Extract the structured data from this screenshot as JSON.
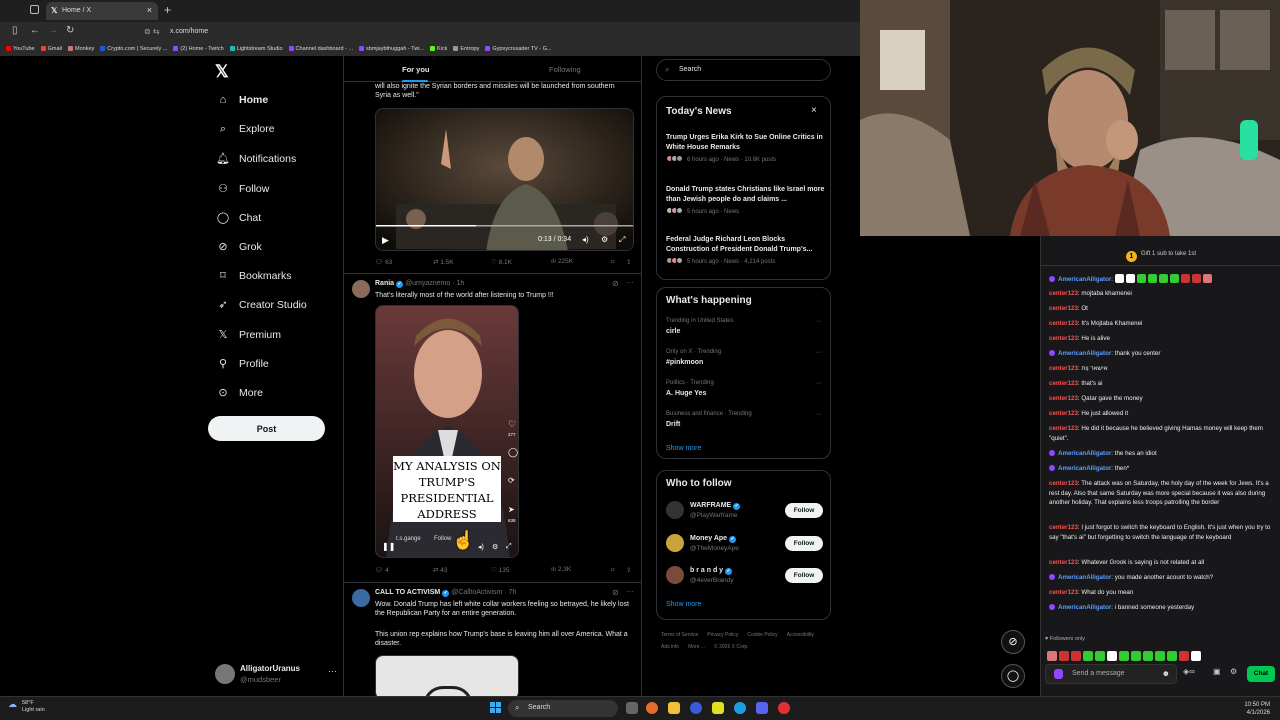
{
  "browser": {
    "tab_title": "Home / X",
    "url": "x.com/home",
    "bookmarks": [
      "YouTube",
      "Gmail",
      "Monkey",
      "Crypto.com | Securely ...",
      "(2) Home - Twitch",
      "Lightstream Studio",
      "Channel dashboard - ...",
      "sbmjaybthuggah - Twi...",
      "Kick",
      "Entropy",
      "Gypsycrusader TV - G..."
    ]
  },
  "nav": {
    "items": [
      {
        "label": "Home",
        "icon": "home-icon"
      },
      {
        "label": "Explore",
        "icon": "search-icon"
      },
      {
        "label": "Notifications",
        "icon": "bell-icon"
      },
      {
        "label": "Follow",
        "icon": "add-person-icon"
      },
      {
        "label": "Chat",
        "icon": "chat-icon"
      },
      {
        "label": "Grok",
        "icon": "grok-icon"
      },
      {
        "label": "Bookmarks",
        "icon": "bookmark-icon"
      },
      {
        "label": "Creator Studio",
        "icon": "rocket-icon"
      },
      {
        "label": "Premium",
        "icon": "x-icon"
      },
      {
        "label": "Profile",
        "icon": "person-icon"
      },
      {
        "label": "More",
        "icon": "more-circle-icon"
      }
    ],
    "post_label": "Post",
    "account": {
      "name": "AlligatorUranus",
      "handle": "@mudsbeer"
    }
  },
  "timeline": {
    "tabs": [
      "For you",
      "Following"
    ],
    "post1": {
      "text": "will also ignite the Syrian borders and missiles will be launched from southern Syria as well.\"",
      "video_time": "0:13 / 0:34",
      "replies": "63",
      "reposts": "1.5K",
      "likes": "8.1K",
      "views": "225K"
    },
    "post2": {
      "name": "Rania",
      "handle": "@umyaznemo",
      "time": "· 1h",
      "text": "That's literally most of the world after listening to Trump !!!",
      "overlay": "MY ANALYSIS ON TRUMP'S PRESIDENTIAL ADDRESS",
      "side_counts": [
        "277",
        "638"
      ],
      "tt_user": "t.s.gange",
      "tt_follow": "Follow",
      "replies": "4",
      "reposts": "43",
      "likes": "135",
      "views": "2.3K"
    },
    "post3": {
      "name": "CALL TO ACTIVISM",
      "handle": "@CalltoActivism",
      "time": "· 7h",
      "text1": "Wow. Donald Trump has left white collar workers feeling so betrayed, he likely lost the Republican Party for an entire generation.",
      "text2": "This union rep explains how Trump's base is leaving him all over America. What a disaster."
    }
  },
  "sidebar": {
    "search_placeholder": "Search",
    "news_title": "Today's News",
    "news": [
      {
        "headline": "Trump Urges Erika Kirk to Sue Online Critics in White House Remarks",
        "meta": "6 hours ago · News · 10.6K posts"
      },
      {
        "headline": "Donald Trump states Christians like Israel more than Jewish people do and claims ...",
        "meta": "5 hours ago · News"
      },
      {
        "headline": "Federal Judge Richard Leon Blocks Construction of President Donald Trump's...",
        "meta": "5 hours ago · News · 4,214 posts"
      }
    ],
    "happening_title": "What's happening",
    "trends": [
      {
        "meta": "Trending in United States",
        "name": "cirle"
      },
      {
        "meta": "Only on X · Trending",
        "name": "#pinkmoon"
      },
      {
        "meta": "Politics · Trending",
        "name": "A. Huge Yes"
      },
      {
        "meta": "Business and finance · Trending",
        "name": "Drift"
      }
    ],
    "show_more": "Show more",
    "wtf_title": "Who to follow",
    "who_to_follow": [
      {
        "name": "WARFRAME",
        "handle": "@PlayWarframe",
        "button": "Follow"
      },
      {
        "name": "Money Ape",
        "handle": "@TheMoneyApe",
        "button": "Follow"
      },
      {
        "name": "b r a n d y",
        "handle": "@4everBrandy",
        "button": "Follow"
      }
    ],
    "footer": [
      "Terms of Service",
      "Privacy Policy",
      "Cookie Policy",
      "Accessibility",
      "Ads info",
      "More ...",
      "© 2026 X Corp."
    ]
  },
  "chat": {
    "gift_text": "Gift 1 sub to take 1st",
    "messages": [
      {
        "user": "AmericanAlligator",
        "color": "#5b9dff",
        "text": "",
        "emotes": true,
        "badge": true
      },
      {
        "user": "center123",
        "color": "#ff4f4f",
        "text": "mojtaba khamenei"
      },
      {
        "user": "center123",
        "color": "#ff4f4f",
        "text": "Ot"
      },
      {
        "user": "center123",
        "color": "#ff4f4f",
        "text": "It's Mojtaba Khamenei"
      },
      {
        "user": "center123",
        "color": "#ff4f4f",
        "text": "He is alive"
      },
      {
        "user": "AmericanAlligator",
        "color": "#5b9dff",
        "text": "thank you center",
        "badge": true
      },
      {
        "user": "center123",
        "color": "#ff4f4f",
        "text": "אישאר ןוח"
      },
      {
        "user": "center123",
        "color": "#ff4f4f",
        "text": "that's ai"
      },
      {
        "user": "center123",
        "color": "#ff4f4f",
        "text": "Qatar gave the money"
      },
      {
        "user": "center123",
        "color": "#ff4f4f",
        "text": "He just allowed it"
      },
      {
        "user": "center123",
        "color": "#ff4f4f",
        "text": "He did it because he believed giving Hamas money will keep them \"quiet\"."
      },
      {
        "user": "AmericanAlligator",
        "color": "#5b9dff",
        "text": "the hes an idiot",
        "badge": true
      },
      {
        "user": "AmericanAlligator",
        "color": "#5b9dff",
        "text": "then*",
        "badge": true
      },
      {
        "user": "center123",
        "color": "#ff4f4f",
        "text": "The attack was on Saturday, the holy day of the week for Jews. It's a rest day. Also that same Saturday was more special because it was also during another holiday. That explains less troops patrolling the border"
      },
      {
        "user": "center123",
        "color": "#ff4f4f",
        "text": "I just forgot to switch the keyboard to English. It's just when you try to say \"that's ai\" but forgetting to switch the language of the keyboard"
      },
      {
        "user": "center123",
        "color": "#ff4f4f",
        "text": "Whatever Grook is saying is not related at all"
      },
      {
        "user": "AmericanAlligator",
        "color": "#5b9dff",
        "text": "you made another acount to watch?",
        "badge": true
      },
      {
        "user": "center123",
        "color": "#ff4f4f",
        "text": "What do you mean"
      },
      {
        "user": "AmericanAlligator",
        "color": "#5b9dff",
        "text": "i banned someone yesterday",
        "badge": true
      }
    ],
    "followers_only": "Followers only",
    "input_placeholder": "Send a message",
    "chat_button": "Chat"
  },
  "taskbar": {
    "temp": "58°F",
    "weather": "Light rain",
    "search": "Search",
    "time": "10:50 PM",
    "date": "4/1/2026"
  }
}
